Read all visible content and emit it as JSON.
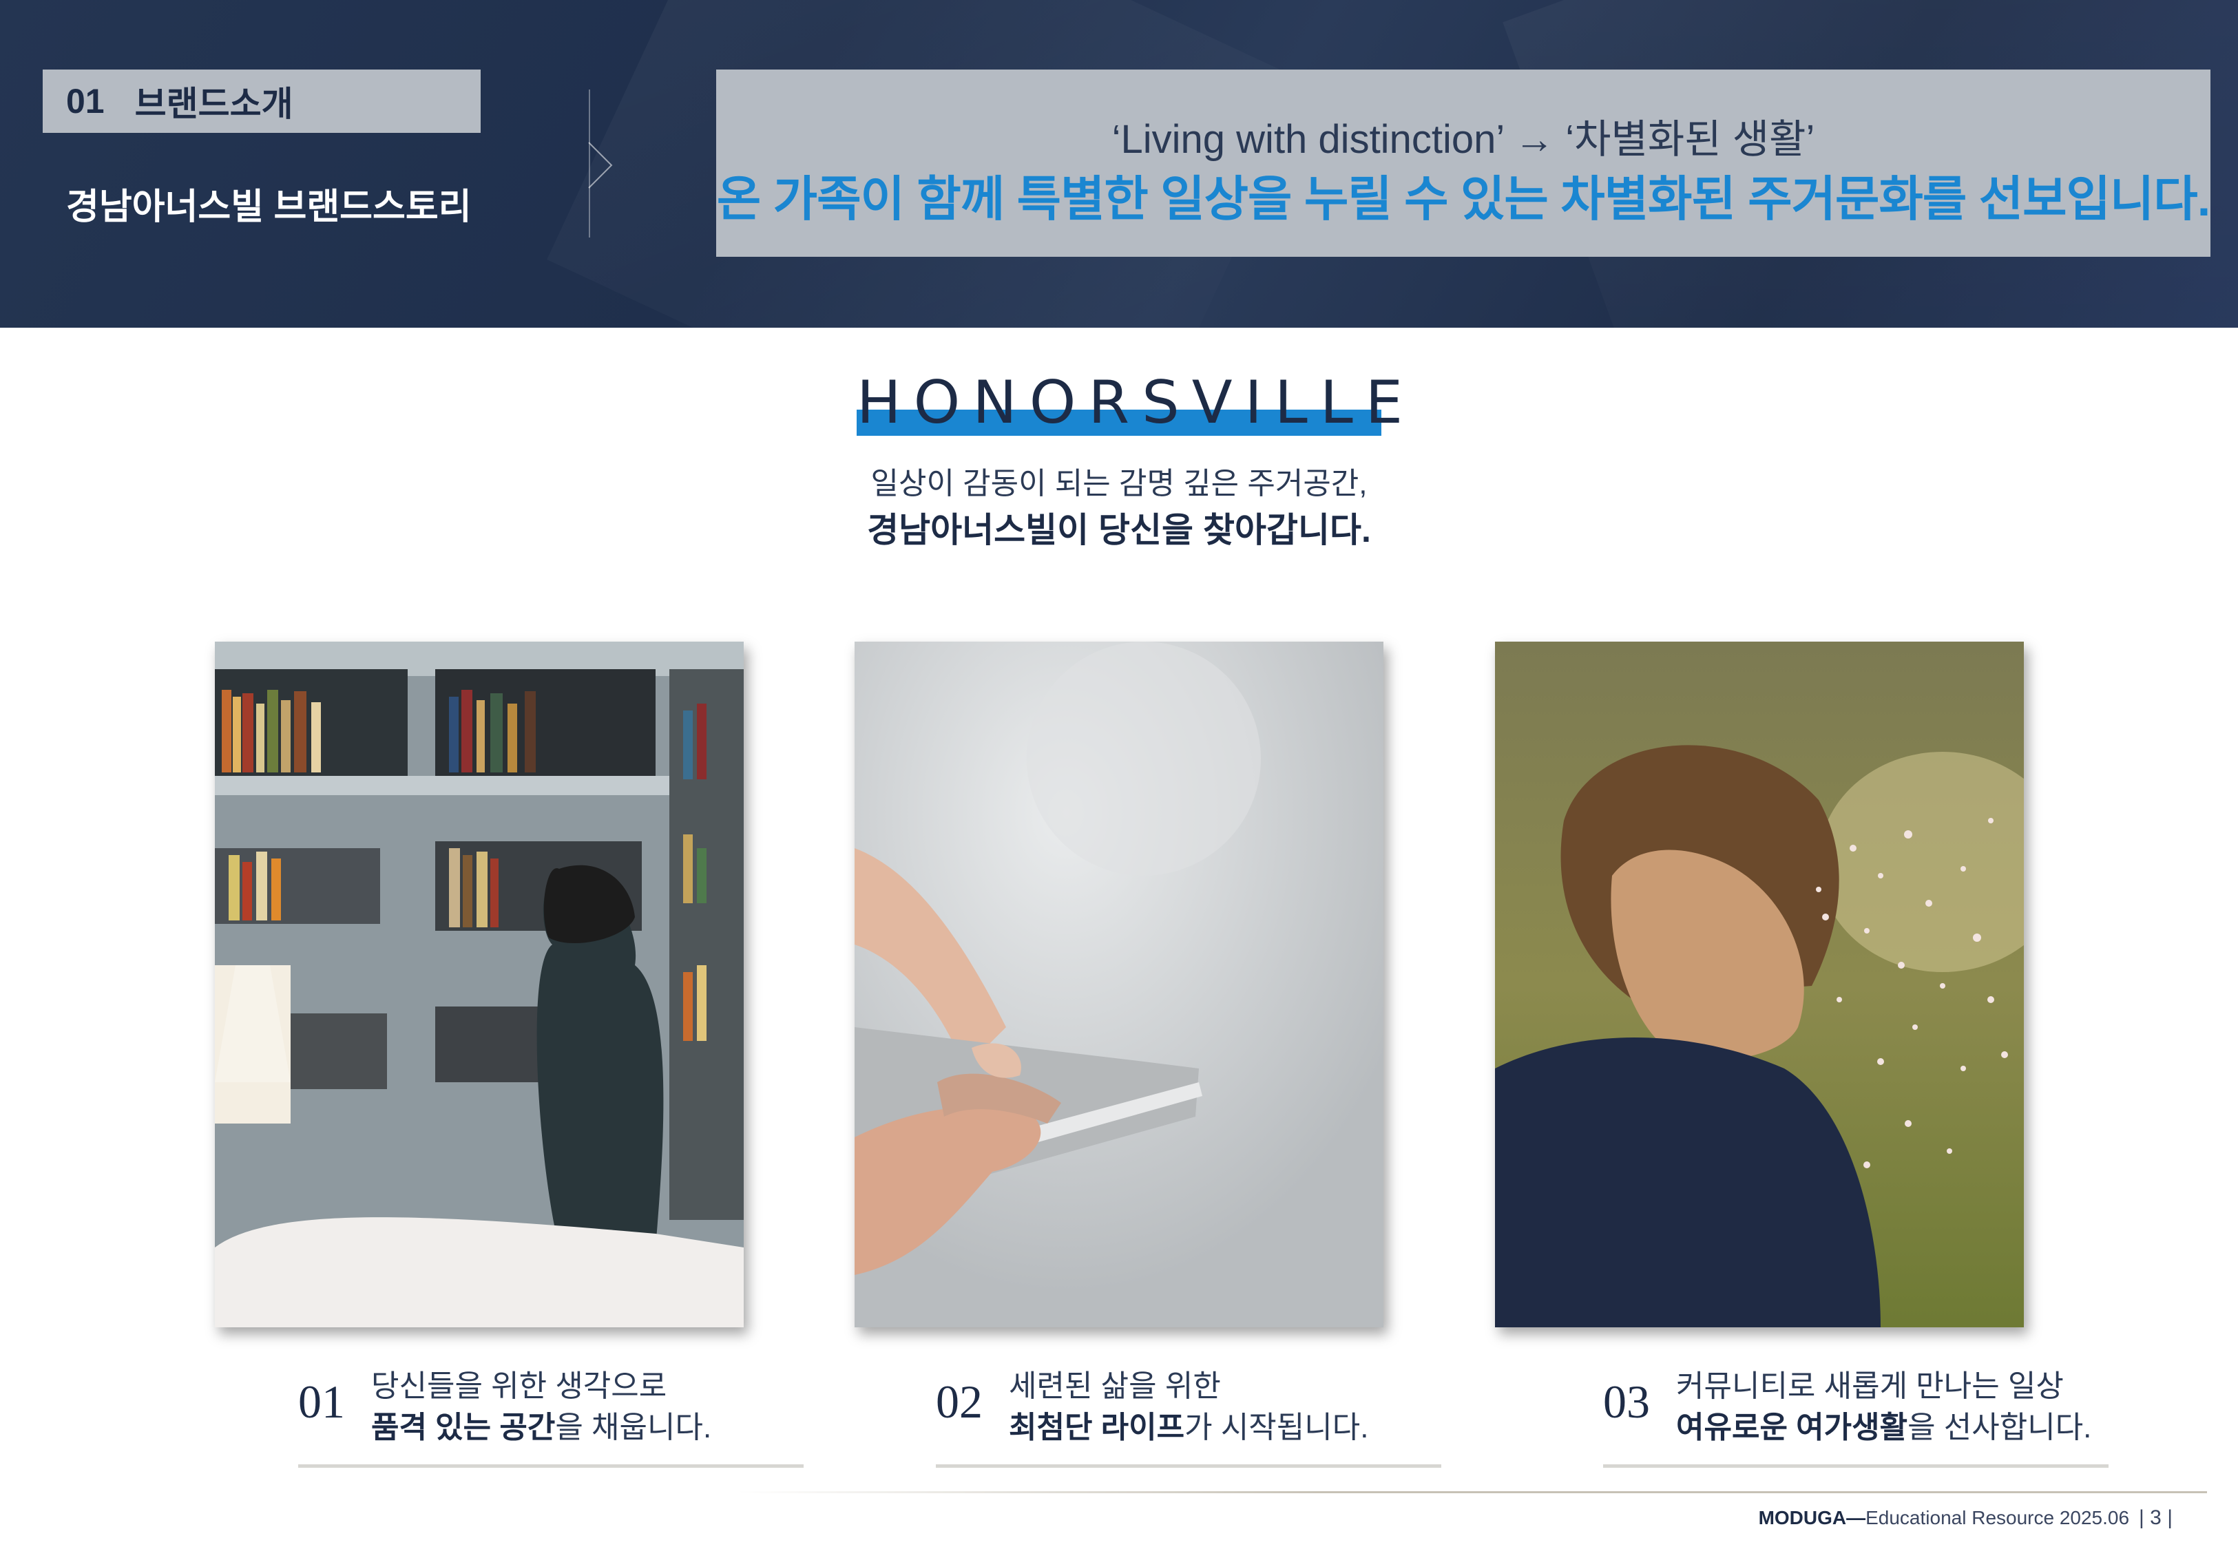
{
  "header": {
    "section_number": "01",
    "section_title": "브랜드소개",
    "subtitle": "경남아너스빌 브랜드스토리",
    "tagline_sub": "‘Living with distinction’ → ‘차별화된 생활’",
    "tagline_main": "온 가족이 함께 특별한 일상을 누릴 수 있는 차별화된 주거문화를 선보입니다."
  },
  "brand": {
    "logo_text": "HONORSVILLE",
    "intro_line1": "일상이 감동이 되는 감명 깊은 주거공간,",
    "intro_line2": "경남아너스빌이 당신을 찾아갑니다."
  },
  "cards": [
    {
      "number": "01",
      "line1": "당신들을 위한 생각으로",
      "line2_bold": "품격 있는 공간",
      "line2_rest": "을 채웁니다.",
      "image": "woman-at-bookshelf"
    },
    {
      "number": "02",
      "line1": "세련된 삶을 위한",
      "line2_bold": "최첨단 라이프",
      "line2_rest": "가 시작됩니다.",
      "image": "hand-holding-smartphone"
    },
    {
      "number": "03",
      "line1": "커뮤니티로 새롭게 만나는 일상",
      "line2_bold": "여유로운 여가생활",
      "line2_rest": "을 선사합니다.",
      "image": "boy-with-water-splash"
    }
  ],
  "footer": {
    "brand": "MODUGA",
    "dash": "—",
    "text": "Educational Resource 2025.06",
    "page": "| 3 |"
  },
  "colors": {
    "navy": "#1d2b46",
    "accent_blue": "#1a86d1",
    "panel_gray": "#b5bbc3"
  }
}
